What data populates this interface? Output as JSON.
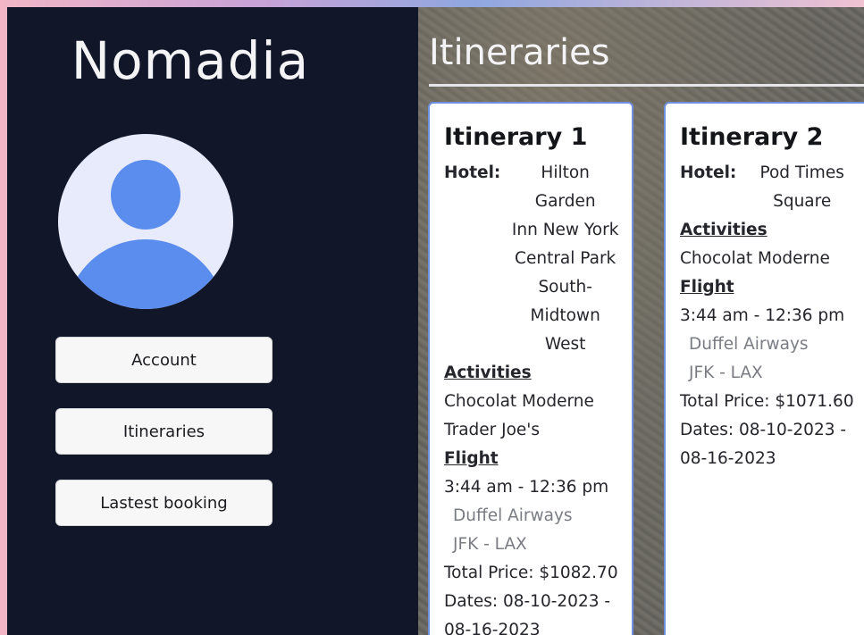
{
  "app": {
    "brand": "Nomadia",
    "page_title": "Itineraries"
  },
  "nav": {
    "account": "Account",
    "itineraries": "Itineraries",
    "latest_booking": "Lastest booking"
  },
  "colors": {
    "sidebar_bg": "#111729",
    "avatar_bg": "#e8ebfb",
    "avatar_fg": "#5b8def",
    "card_border": "#6f8fe0"
  },
  "itineraries": [
    {
      "title": "Itinerary 1",
      "hotel_label": "Hotel:",
      "hotel_lines": [
        "Hilton Garden",
        "Inn New York",
        "Central Park",
        "South-",
        "Midtown",
        "West"
      ],
      "activities_label": "Activities",
      "activities": [
        "Chocolat Moderne",
        "Trader Joe's"
      ],
      "flight_label": "Flight",
      "flight_time": "3:44 am - 12:36 pm",
      "airline": "Duffel Airways",
      "route": "JFK - LAX",
      "total_price": "Total Price: $1082.70",
      "dates_line1": "Dates: 08-10-2023 -",
      "dates_line2": "08-16-2023"
    },
    {
      "title": "Itinerary 2",
      "hotel_label": "Hotel:",
      "hotel_lines": [
        "Pod Times",
        "Square"
      ],
      "activities_label": "Activities",
      "activities": [
        "Chocolat Moderne"
      ],
      "flight_label": "Flight",
      "flight_time": "3:44 am - 12:36 pm",
      "airline": "Duffel Airways",
      "route": "JFK - LAX",
      "total_price": "Total Price: $1071.60",
      "dates_line1": "Dates: 08-10-2023 -",
      "dates_line2": "08-16-2023"
    }
  ]
}
